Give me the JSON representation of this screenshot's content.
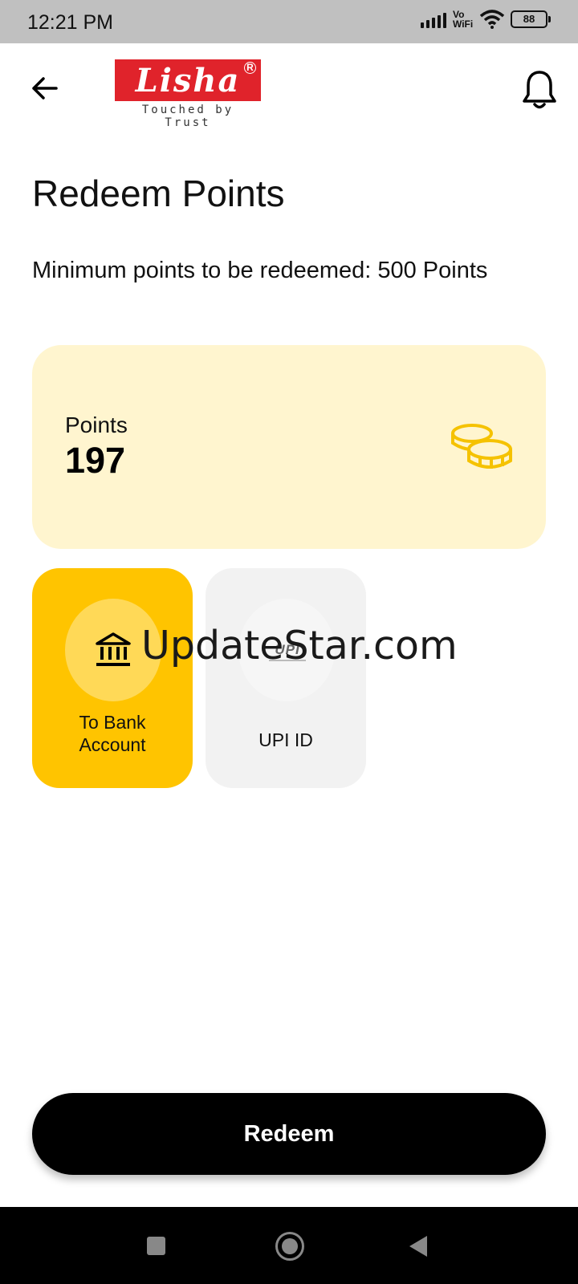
{
  "status_bar": {
    "time": "12:21 PM",
    "network": "Vo WiFi",
    "battery": "88",
    "icons": [
      "signal-icon",
      "vowifi-icon",
      "wifi-icon",
      "battery-icon"
    ]
  },
  "header": {
    "back_icon": "arrow-left-icon",
    "logo_text": "Lisha",
    "logo_tagline": "Touched by Trust",
    "notification_icon": "bell-icon",
    "brand_color": "#e0232b"
  },
  "page": {
    "title": "Redeem Points",
    "min_points_text": "Minimum points to be redeemed:  500 Points"
  },
  "points_card": {
    "label": "Points",
    "value": "197",
    "icon": "coins-icon",
    "background": "#fff5cf",
    "icon_color": "#f5c200"
  },
  "options": [
    {
      "label": "To Bank Account",
      "icon": "bank-icon",
      "selected": true,
      "background": "#ffc400"
    },
    {
      "label": "UPI ID",
      "icon": "upi-logo-icon",
      "logo_text": "UPI",
      "selected": false,
      "background": "#f2f2f2"
    }
  ],
  "watermark": "UpdateStar.com",
  "redeem_button": {
    "label": "Redeem"
  },
  "nav_bar": {
    "icons": [
      "recent-apps-icon",
      "home-icon",
      "back-triangle-icon"
    ]
  }
}
